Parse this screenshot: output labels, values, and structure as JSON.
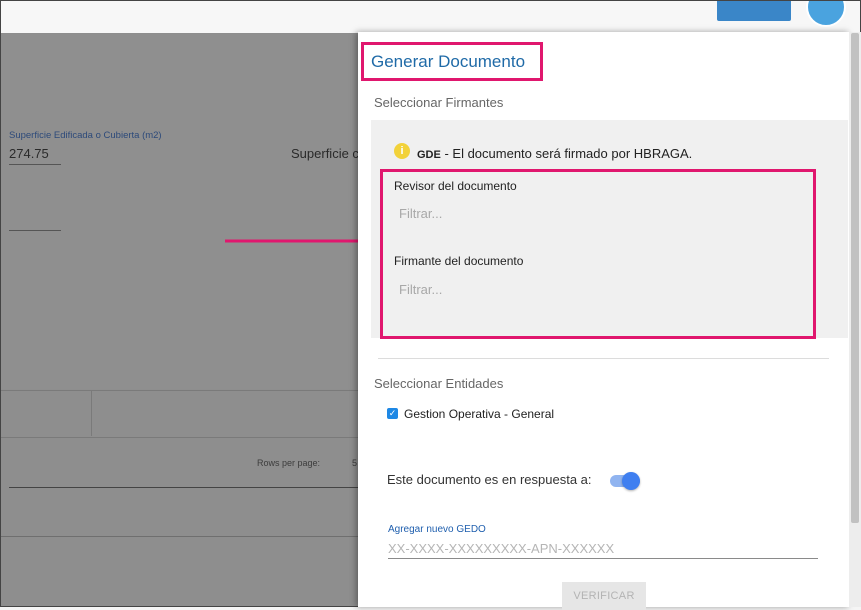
{
  "background": {
    "field_label": "Superficie Edificada o Cubierta (m2)",
    "field_value": "274.75",
    "field2_label": "Superficie c",
    "rows_per_page_label": "Rows per page:",
    "rows_per_page_value": "5"
  },
  "dialog": {
    "title": "Generar Documento",
    "section_firmantes": "Seleccionar Firmantes",
    "info_icon": "info-icon",
    "gde_prefix": "GDE",
    "gde_text": " - El documento será firmado por HBRAGA.",
    "revisor_label": "Revisor del documento",
    "revisor_placeholder": "Filtrar...",
    "firmante_label": "Firmante del documento",
    "firmante_placeholder": "Filtrar...",
    "section_entidades": "Seleccionar Entidades",
    "entidad_label": "Gestion Operativa - General",
    "entidad_checked": true,
    "respuesta_label": "Este documento es en respuesta a:",
    "respuesta_toggle_on": true,
    "gedo_label": "Agregar nuevo GEDO",
    "gedo_placeholder": "XX-XXXX-XXXXXXXXX-APN-XXXXXX",
    "verify_label": "VERIFICAR"
  },
  "colors": {
    "accent": "#1e88e5",
    "highlight": "#e0176e",
    "title": "#1f6aa7"
  }
}
